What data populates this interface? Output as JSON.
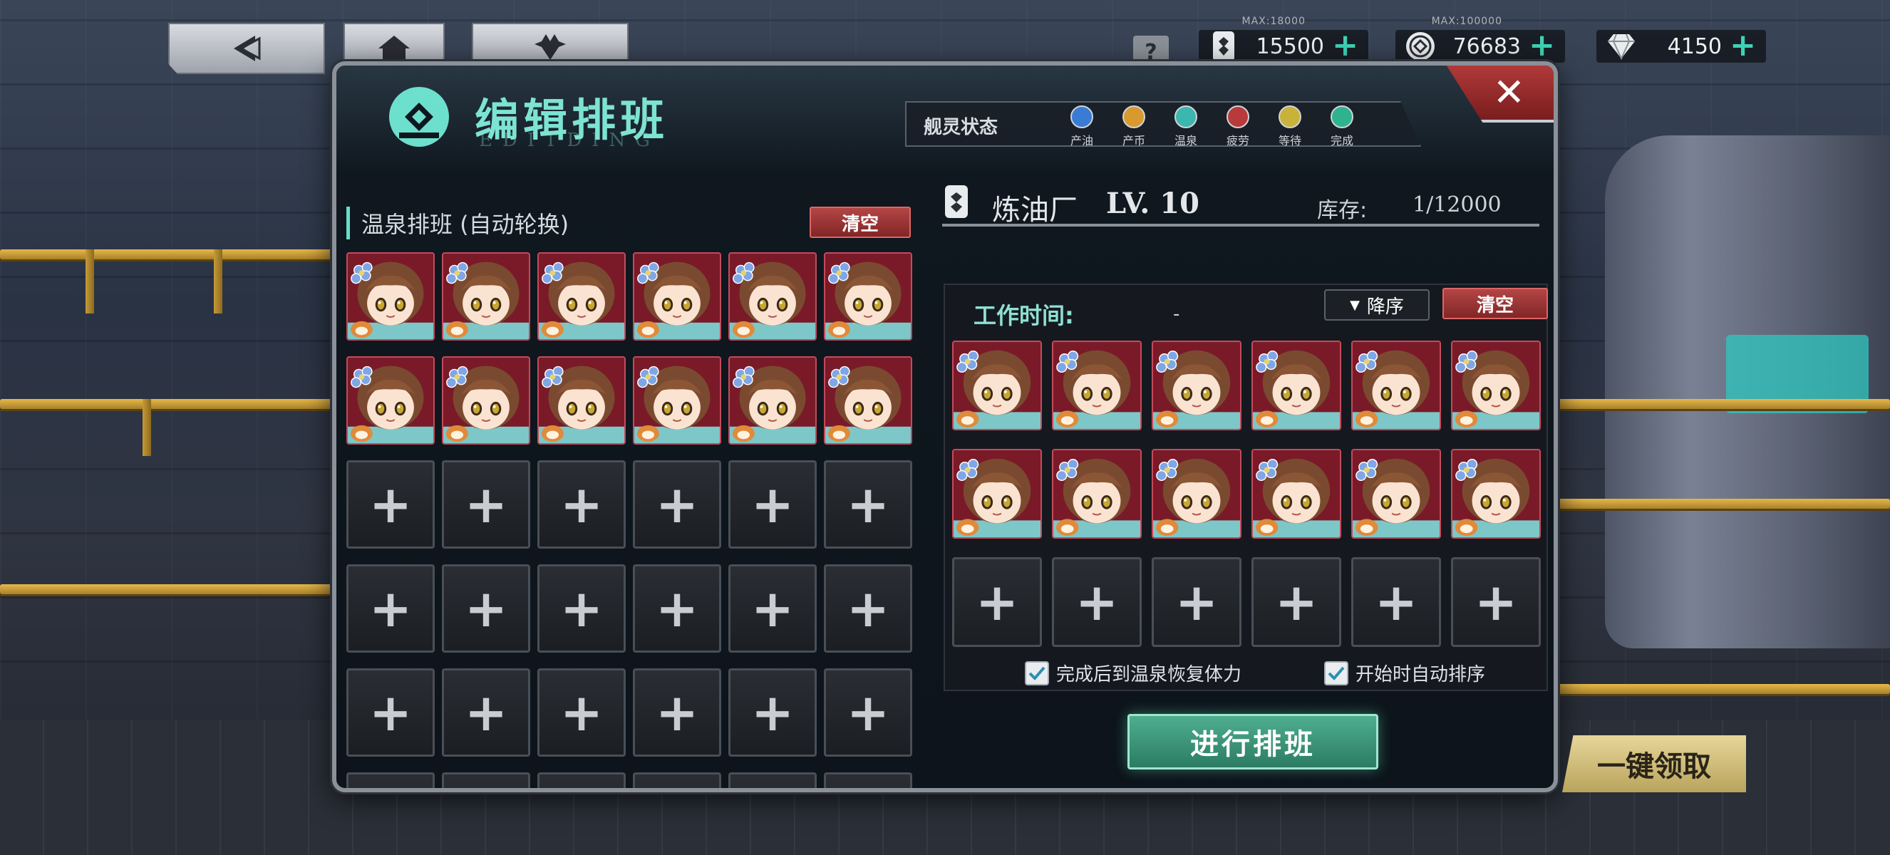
{
  "currencies": [
    {
      "cap": "MAX:18000",
      "value": "15500",
      "icon": "oil-barrel-icon"
    },
    {
      "cap": "MAX:100000",
      "value": "76683",
      "icon": "coin-icon"
    },
    {
      "cap": "",
      "value": "4150",
      "icon": "diamond-icon"
    }
  ],
  "top_nav": {
    "help": "?"
  },
  "panel": {
    "title": "编辑排班",
    "subtitle": "EDITDING",
    "close": "✕"
  },
  "status": {
    "label": "舰灵状态",
    "items": [
      {
        "label": "产油",
        "color": "#3a7bd5"
      },
      {
        "label": "产币",
        "color": "#d89a2e"
      },
      {
        "label": "温泉",
        "color": "#3bb7b0"
      },
      {
        "label": "疲劳",
        "color": "#b83a3a"
      },
      {
        "label": "等待",
        "color": "#c9b23a"
      },
      {
        "label": "完成",
        "color": "#2fb38f"
      }
    ]
  },
  "left": {
    "title": "温泉排班 (自动轮换)",
    "clear": "清空",
    "filled_count": 12,
    "slot_plus": "+"
  },
  "right": {
    "facility": "炼油厂",
    "level": "LV. 10",
    "stock_label": "库存:",
    "stock_value": "1/12000",
    "work_label": "工作时间:",
    "work_value": "-",
    "sort": "降序",
    "sort_arrow": "▼",
    "clear": "清空",
    "check1": "完成后到温泉恢复体力",
    "check2": "开始时自动排序",
    "go": "进行排班"
  },
  "claim": "一键领取"
}
